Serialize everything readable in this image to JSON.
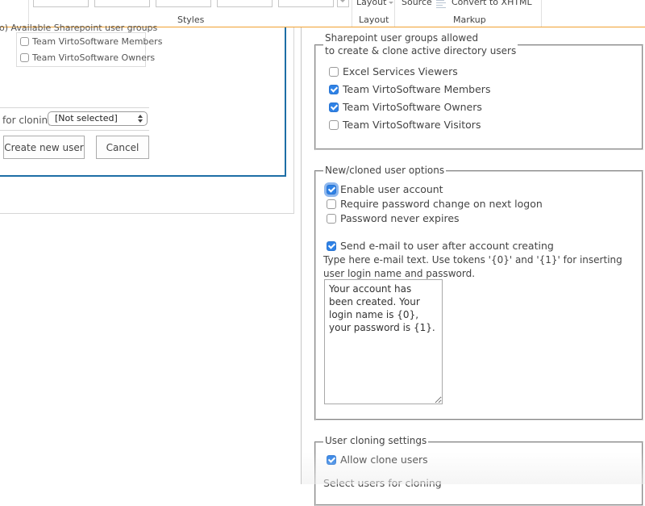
{
  "ribbon": {
    "groups": {
      "styles_label": "Styles",
      "layout_label": "Layout",
      "markup_label": "Markup"
    },
    "commands": {
      "layout": "Layout",
      "source": "Source",
      "convert": "Convert to XHTML"
    },
    "icons": {
      "layout_dropdown": "chevron-down-icon",
      "convert": "convert-xhtml-icon",
      "styles_scroll": "chevron-down-icon"
    }
  },
  "left_panel": {
    "available_groups_label": "o)   Available Sharepoint user groups",
    "available_groups": [
      {
        "label": "Team VirtoSoftware Members",
        "checked": false
      },
      {
        "label": "Team VirtoSoftware Owners",
        "checked": false
      }
    ],
    "clone_label": "for cloning",
    "clone_select": {
      "value": "[Not selected]"
    },
    "create_button": "Create new user",
    "cancel_button": "Cancel"
  },
  "right_panel": {
    "allowed_groups": {
      "legend_line1": "Sharepoint user groups allowed",
      "legend_line2": "to create & clone active directory users",
      "items": [
        {
          "label": "Excel Services Viewers",
          "checked": false
        },
        {
          "label": "Team VirtoSoftware Members",
          "checked": true
        },
        {
          "label": "Team VirtoSoftware Owners",
          "checked": true
        },
        {
          "label": "Team VirtoSoftware Visitors",
          "checked": false
        }
      ]
    },
    "user_options": {
      "legend": "New/cloned user options",
      "items": [
        {
          "label": "Enable user account",
          "checked": true
        },
        {
          "label": "Require password change on next logon",
          "checked": false
        },
        {
          "label": "Password never expires",
          "checked": false
        }
      ],
      "send_email": {
        "label": "Send e-mail to user after account creating",
        "checked": true
      },
      "help_text": "Type here e-mail text. Use tokens '{0}' and '{1}' for inserting user login name and password.",
      "email_text": "Your account has been created. Your login name is {0}, your password is {1}."
    },
    "cloning_settings": {
      "legend": "User cloning settings",
      "allow_clone": {
        "label": "Allow clone users",
        "checked": true
      },
      "select_users_label": "Select users for cloning"
    }
  },
  "colors": {
    "accent_orange": "#f0a030",
    "panel_border_blue": "#1e6ea6",
    "checkbox_blue": "#2f82e6"
  }
}
